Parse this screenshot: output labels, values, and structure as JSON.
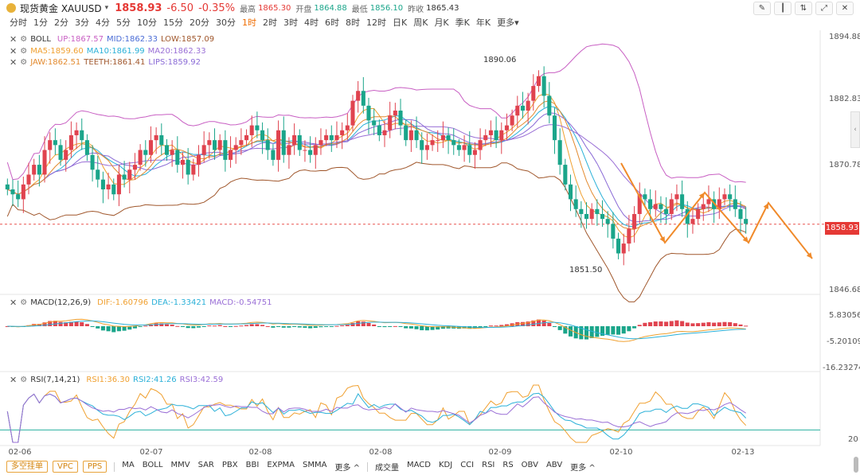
{
  "header": {
    "symbol": "现货黄金 XAUUSD",
    "price": "1858.93",
    "change": "-6.50",
    "change_pct": "-0.35%",
    "high_label": "最高",
    "high": "1865.30",
    "open_label": "开盘",
    "open": "1864.88",
    "low_label": "最低",
    "low": "1856.10",
    "prev_label": "昨收",
    "prev": "1865.43"
  },
  "periods": [
    "分时",
    "1分",
    "2分",
    "3分",
    "4分",
    "5分",
    "10分",
    "15分",
    "20分",
    "30分",
    "1时",
    "2时",
    "3时",
    "4时",
    "6时",
    "8时",
    "12时",
    "日K",
    "周K",
    "月K",
    "季K",
    "年K",
    "更多▾"
  ],
  "active_period": "1时",
  "legends": {
    "boll": {
      "name": "BOLL",
      "up": "UP:1867.57",
      "mid": "MID:1862.33",
      "low": "LOW:1857.09"
    },
    "ma": {
      "ma5": "MA5:1859.60",
      "ma10": "MA10:1861.99",
      "ma20": "MA20:1862.33"
    },
    "alligator": {
      "jaw": "JAW:1862.51",
      "teeth": "TEETH:1861.41",
      "lips": "LIPS:1859.92"
    },
    "macd": {
      "name": "MACD(12,26,9)",
      "dif": "DIF:-1.60796",
      "dea": "DEA:-1.33421",
      "macd": "MACD:-0.54751"
    },
    "rsi": {
      "name": "RSI(7,14,21)",
      "rsi1": "RSI1:36.30",
      "rsi2": "RSI2:41.26",
      "rsi3": "RSI3:42.59"
    }
  },
  "colors": {
    "up": "#e0434f",
    "down": "#1aa58a",
    "boll_up": "#c85fc3",
    "boll_mid": "#4a6cd6",
    "boll_low": "#a0572c",
    "ma5": "#f0a030",
    "ma10": "#2ab0d8",
    "ma20": "#9a6fd6",
    "jaw": "#e38a2e",
    "teeth": "#a0572c",
    "lips": "#8a6ad6",
    "dif": "#f0a030",
    "dea": "#2ab0d8",
    "rsi1": "#f0a030",
    "rsi2": "#2ab0d8",
    "rsi3": "#9a6fd6"
  },
  "price_axis": [
    "1894.88",
    "1882.83",
    "1870.78",
    "1858.93",
    "1846.68"
  ],
  "macd_axis": [
    "5.83056",
    "-5.20109",
    "-16.23274"
  ],
  "rsi_axis": [
    "20"
  ],
  "current_price_tag": "1858.93",
  "annotations": {
    "high": "1890.06",
    "low": "1851.50"
  },
  "date_labels": [
    "02-06",
    "02-07",
    "02-08",
    "02-08",
    "02-09",
    "02-10",
    "02-13"
  ],
  "footer": {
    "buttons": [
      "多空挂单",
      "VPC",
      "PPS"
    ],
    "main_indicators": [
      "MA",
      "BOLL",
      "MMV",
      "SAR",
      "PBX",
      "BBI",
      "EXPMA",
      "SMMA",
      "更多 ^"
    ],
    "sub_indicators": [
      "成交量",
      "MACD",
      "KDJ",
      "CCI",
      "RSI",
      "RS",
      "OBV",
      "ABV",
      "更多 ^"
    ]
  },
  "toolbar_icons": [
    "draw-icon",
    "candle-type-icon",
    "compare-icon",
    "fullscreen-icon",
    "close-icon"
  ],
  "chart_data": {
    "type": "candlestick",
    "title": "现货黄金 XAUUSD 1时",
    "price_range": [
      1845,
      1898
    ],
    "labeled_prices": [
      1894.88,
      1882.83,
      1870.78,
      1858.93,
      1846.68
    ],
    "high_point": 1890.06,
    "low_point": 1851.5,
    "last_price": 1858.93,
    "x_dates": [
      "02-06",
      "02-07",
      "02-08",
      "02-08",
      "02-09",
      "02-10",
      "02-13"
    ],
    "closes": [
      1866,
      1865,
      1864,
      1867,
      1869,
      1871,
      1869,
      1874,
      1876,
      1875,
      1872,
      1874,
      1877,
      1878,
      1876,
      1873,
      1870,
      1868,
      1866,
      1867,
      1865,
      1869,
      1868,
      1870,
      1871,
      1874,
      1873,
      1876,
      1877,
      1875,
      1873,
      1874,
      1871,
      1872,
      1869,
      1871,
      1873,
      1875,
      1876,
      1874,
      1876,
      1872,
      1874,
      1875,
      1876,
      1877,
      1879,
      1878,
      1876,
      1874,
      1872,
      1878,
      1873,
      1875,
      1877,
      1874,
      1874,
      1873,
      1875,
      1876,
      1877,
      1876,
      1877,
      1878,
      1879,
      1884,
      1886,
      1883,
      1880,
      1879,
      1877,
      1878,
      1881,
      1882,
      1879,
      1876,
      1878,
      1876,
      1874,
      1875,
      1876,
      1876,
      1877,
      1876,
      1875,
      1874,
      1875,
      1873,
      1874,
      1876,
      1877,
      1878,
      1876,
      1878,
      1879,
      1881,
      1883,
      1882,
      1884,
      1887,
      1889,
      1885,
      1881,
      1876,
      1871,
      1867,
      1864,
      1862,
      1861,
      1860,
      1862,
      1861,
      1860,
      1859,
      1856,
      1853,
      1855,
      1858,
      1861,
      1865,
      1864,
      1862,
      1863,
      1862,
      1861,
      1864,
      1865,
      1862,
      1859,
      1860,
      1862,
      1863,
      1864,
      1862,
      1864,
      1865,
      1864,
      1862,
      1860,
      1859
    ],
    "macd_hist_range": [
      -6,
      6
    ],
    "rsi_range": [
      0,
      100
    ],
    "projection_arrows": "orange zig-zag forecast lines on right"
  }
}
